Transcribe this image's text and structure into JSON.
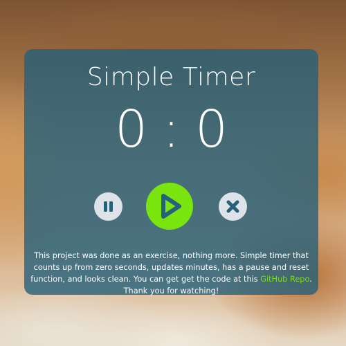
{
  "app": {
    "title": "Simple Timer"
  },
  "timer": {
    "minutes": "0",
    "separator": ":",
    "seconds": "0"
  },
  "controls": {
    "pause_icon": "pause-icon",
    "play_icon": "play-icon",
    "reset_icon": "close-icon"
  },
  "description": {
    "text_before": "This project was done as an exercise, nothing more. Simple timer that counts up from zero seconds, updates minutes, has a pause and reset function, and looks clean. You can get get the code at this ",
    "link_text": "GitHub Repo",
    "text_after": ". Thank you for watching!"
  },
  "colors": {
    "card_bg": "#26607a",
    "accent_green": "#7ae40f",
    "button_grey": "#dde3e8",
    "icon_blue": "#26607a"
  }
}
